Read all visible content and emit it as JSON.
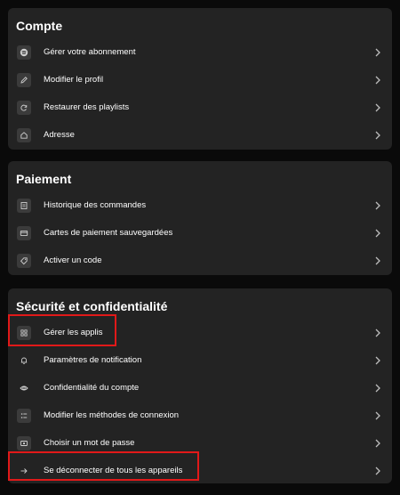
{
  "sections": [
    {
      "title": "Compte",
      "items": [
        {
          "label": "Gérer votre abonnement",
          "icon": "spotify-icon"
        },
        {
          "label": "Modifier le profil",
          "icon": "pencil-icon"
        },
        {
          "label": "Restaurer des playlists",
          "icon": "refresh-icon"
        },
        {
          "label": "Adresse",
          "icon": "home-icon"
        }
      ]
    },
    {
      "title": "Paiement",
      "items": [
        {
          "label": "Historique des commandes",
          "icon": "receipt-icon"
        },
        {
          "label": "Cartes de paiement sauvegardées",
          "icon": "card-icon"
        },
        {
          "label": "Activer un code",
          "icon": "tag-icon"
        }
      ]
    },
    {
      "title": "Sécurité et confidentialité",
      "items": [
        {
          "label": "Gérer les applis",
          "icon": "grid-icon"
        },
        {
          "label": "Paramètres de notification",
          "icon": "bell-icon"
        },
        {
          "label": "Confidentialité du compte",
          "icon": "eye-icon"
        },
        {
          "label": "Modifier les méthodes de connexion",
          "icon": "list-icon"
        },
        {
          "label": "Choisir un mot de passe",
          "icon": "password-icon"
        },
        {
          "label": "Se déconnecter de tous les appareils",
          "icon": "logout-arrow-icon"
        }
      ]
    }
  ],
  "colors": {
    "background": "#0a0a0a",
    "card": "#232323",
    "highlight": "#e11919",
    "icon_bg": "#3b3b3b"
  }
}
